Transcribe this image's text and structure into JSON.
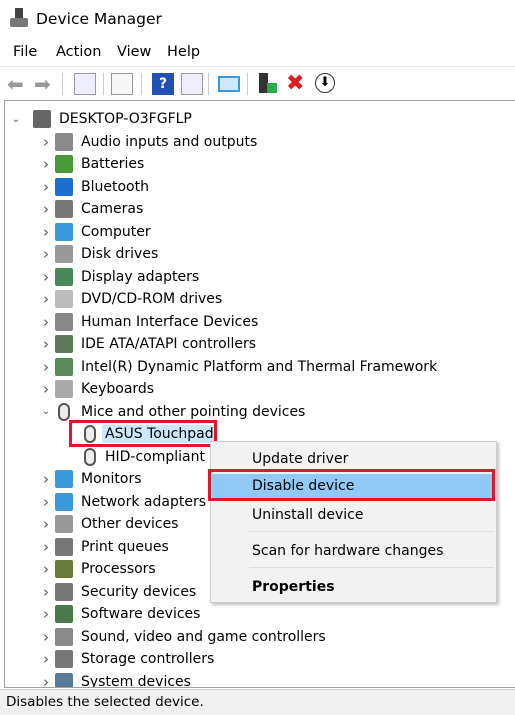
{
  "window": {
    "title": "Device Manager"
  },
  "menu": [
    "File",
    "Action",
    "View",
    "Help"
  ],
  "toolbar": [
    "back-icon",
    "forward-icon",
    "show-hide-console-tree-icon",
    "properties-icon",
    "help-icon",
    "show-action-pane-icon",
    "scan-hardware-icon",
    "update-driver-icon",
    "uninstall-icon",
    "disable-icon"
  ],
  "tree": {
    "root": "DESKTOP-O3FGFLP",
    "categories": [
      {
        "label": "Audio inputs and outputs",
        "icon": "speaker-icon"
      },
      {
        "label": "Batteries",
        "icon": "battery-icon"
      },
      {
        "label": "Bluetooth",
        "icon": "bluetooth-icon"
      },
      {
        "label": "Cameras",
        "icon": "camera-icon"
      },
      {
        "label": "Computer",
        "icon": "monitor-icon"
      },
      {
        "label": "Disk drives",
        "icon": "disk-icon"
      },
      {
        "label": "Display adapters",
        "icon": "display-adapter-icon"
      },
      {
        "label": "DVD/CD-ROM drives",
        "icon": "dvd-icon"
      },
      {
        "label": "Human Interface Devices",
        "icon": "hid-icon"
      },
      {
        "label": "IDE ATA/ATAPI controllers",
        "icon": "ide-icon"
      },
      {
        "label": "Intel(R) Dynamic Platform and Thermal Framework",
        "icon": "chip-icon"
      },
      {
        "label": "Keyboards",
        "icon": "keyboard-icon"
      },
      {
        "label": "Mice and other pointing devices",
        "icon": "mouse-icon",
        "expanded": true
      },
      {
        "label": "ASUS Touchpad",
        "icon": "mouse-icon",
        "child": true,
        "selected": true
      },
      {
        "label": "HID-compliant mouse",
        "icon": "mouse-icon",
        "child": true,
        "visible_text": "HID-compliant m"
      },
      {
        "label": "Monitors",
        "icon": "monitor-icon"
      },
      {
        "label": "Network adapters",
        "icon": "network-icon"
      },
      {
        "label": "Other devices",
        "icon": "unknown-device-icon"
      },
      {
        "label": "Print queues",
        "icon": "printer-icon"
      },
      {
        "label": "Processors",
        "icon": "processor-icon"
      },
      {
        "label": "Security devices",
        "icon": "security-icon"
      },
      {
        "label": "Software devices",
        "icon": "software-device-icon"
      },
      {
        "label": "Sound, video and game controllers",
        "icon": "speaker-icon"
      },
      {
        "label": "Storage controllers",
        "icon": "storage-icon"
      },
      {
        "label": "System devices",
        "icon": "system-icon"
      }
    ]
  },
  "context_menu": {
    "items": [
      "Update driver",
      "Disable device",
      "Uninstall device",
      "Scan for hardware changes",
      "Properties"
    ],
    "highlighted": "Disable device"
  },
  "status": "Disables the selected device.",
  "colors": {
    "highlight": "#91c9f7",
    "annotation": "#e0162b",
    "selection": "#cce8ff"
  }
}
